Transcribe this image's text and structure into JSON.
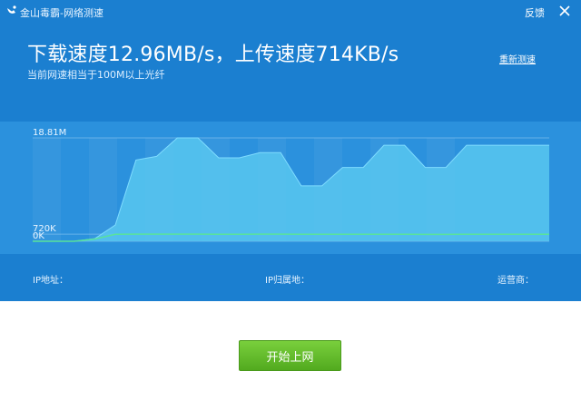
{
  "window": {
    "title": "金山毒霸-网络测速",
    "feedback_label": "反馈"
  },
  "result": {
    "headline": "下载速度12.96MB/s，上传速度714KB/s",
    "subtitle": "当前网速相当于100M以上光纤",
    "retest_label": "重新测速"
  },
  "chart_data": {
    "type": "area",
    "ytick_labels": [
      "18.81M",
      "720K",
      "0K"
    ],
    "series": [
      {
        "values": [
          0,
          0,
          0,
          0.35,
          2.2,
          11.0,
          11.5,
          14.0,
          14.0,
          11.3,
          11.3,
          12.0,
          12.0,
          7.5,
          7.5,
          10.0,
          10.0,
          13.0,
          13.0,
          10.0,
          10.0,
          13.0,
          13.0,
          13.0,
          13.0,
          13.0
        ]
      },
      {
        "values": [
          0,
          0,
          0,
          0.3,
          0.95,
          0.96,
          0.96,
          0.96,
          0.96,
          0.95,
          0.95,
          0.96,
          0.96,
          0.95,
          0.95,
          0.95,
          0.95,
          0.95,
          0.95,
          0.94,
          0.94,
          0.95,
          0.95,
          0.95,
          0.95,
          0.95
        ]
      }
    ],
    "colors": {
      "download_fill": "#58c7f0",
      "upload_line": "#59e39a"
    }
  },
  "info": {
    "ip_label": "IP地址：",
    "location_label": "IP归属地：",
    "isp_label": "运营商："
  },
  "start_button_label": "开始上网"
}
